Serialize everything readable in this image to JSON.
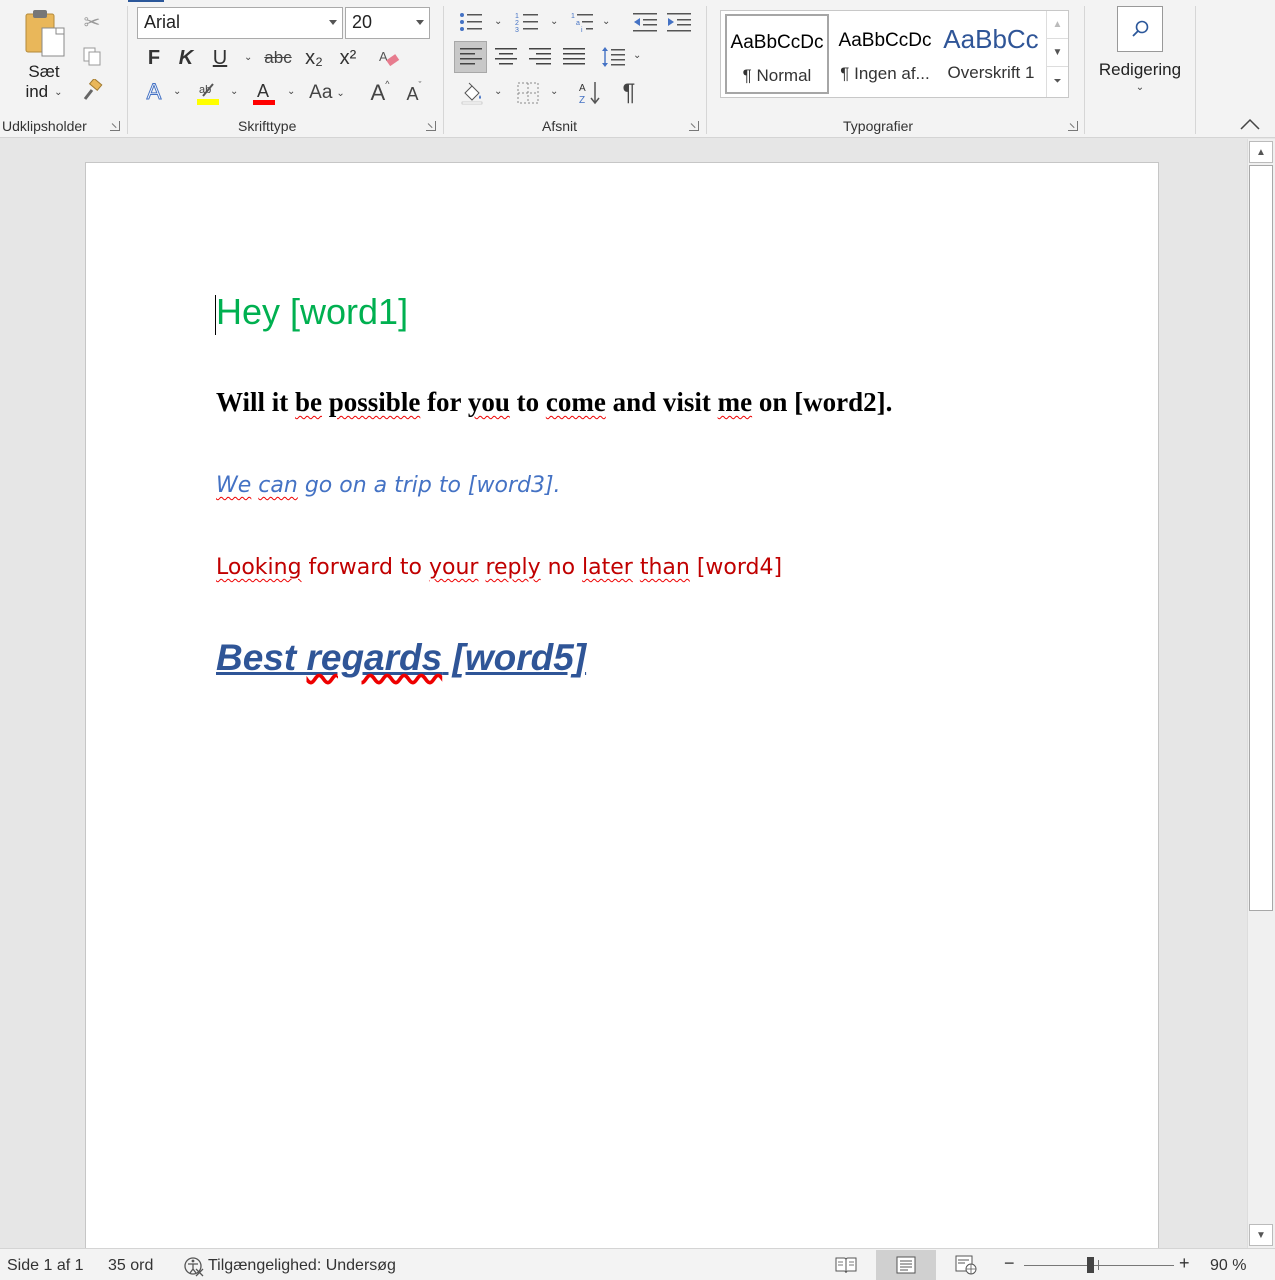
{
  "ribbon": {
    "clipboard": {
      "group_label": "Udklipsholder",
      "paste_label_line1": "Sæt",
      "paste_label_line2": "ind"
    },
    "font": {
      "group_label": "Skrifttype",
      "font_name": "Arial",
      "font_size": "20",
      "bold_label": "F",
      "italic_label": "K",
      "underline_label": "U",
      "strikethrough_label": "abc",
      "subscript_label": "x₂",
      "superscript_label": "x²",
      "change_case_label": "Aa",
      "grow_font_label": "A",
      "shrink_font_label": "A"
    },
    "paragraph": {
      "group_label": "Afsnit",
      "show_marks_label": "¶"
    },
    "styles": {
      "group_label": "Typografier",
      "items": [
        {
          "sample": "AaBbCcDc",
          "name": "¶ Normal"
        },
        {
          "sample": "AaBbCcDc",
          "name": "¶ Ingen af..."
        },
        {
          "sample": "AaBbCc",
          "name": "Overskrift 1"
        }
      ]
    },
    "editing": {
      "label": "Redigering"
    }
  },
  "document": {
    "line1": "Hey [word1]",
    "line2": {
      "w1": "Will it ",
      "sq1": "be",
      "w2": " ",
      "sq2": "possible",
      "w3": " for ",
      "sq3": "you",
      "w4": " to ",
      "sq4": "come",
      "w5": " and visit ",
      "sq5": "me",
      "w6": " on [word2]."
    },
    "line3": {
      "sq1": "We",
      "w1": " ",
      "sq2": "can",
      "w2": " go on a trip to [word3]."
    },
    "line4": {
      "sq1": "Looking",
      "w1": " forward to ",
      "sq2": "your",
      "w2": " ",
      "sq3": "reply",
      "w3": " no ",
      "sq4": "later",
      "w4": " ",
      "sq5": "than",
      "w5": " [word4]"
    },
    "line5": {
      "w1": "Best ",
      "sq1": "regards",
      "w2": " [word5]"
    }
  },
  "status": {
    "page": "Side 1 af 1",
    "words": "35 ord",
    "accessibility": "Tilgængelighed: Undersøg",
    "zoom": "90 %"
  },
  "colors": {
    "line1": "#00b050",
    "line3": "#4472c4",
    "line4": "#c00000",
    "line5": "#2f5597",
    "accent": "#2b579a"
  }
}
